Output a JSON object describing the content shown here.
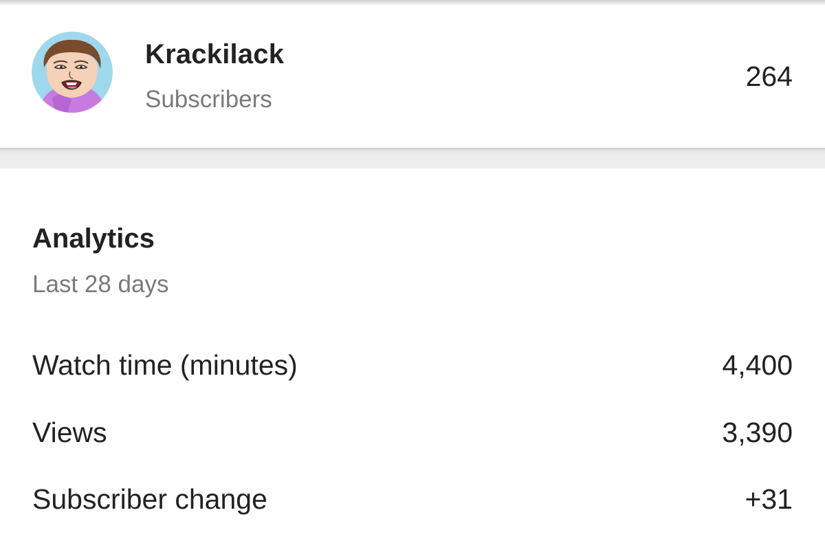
{
  "channel": {
    "name": "Krackilack",
    "subscribers_label": "Subscribers",
    "subscribers_count": "264",
    "avatar_icon": "avatar-cartoon-face-icon"
  },
  "analytics": {
    "title": "Analytics",
    "period": "Last 28 days",
    "metrics": [
      {
        "label": "Watch time (minutes)",
        "value": "4,400"
      },
      {
        "label": "Views",
        "value": "3,390"
      },
      {
        "label": "Subscriber change",
        "value": "+31"
      }
    ]
  },
  "colors": {
    "primary_text": "#222222",
    "secondary_text": "#7a7a7a",
    "separator": "#efefef",
    "avatar_background": "#9fd8ec",
    "hoodie": "#c77be0"
  }
}
